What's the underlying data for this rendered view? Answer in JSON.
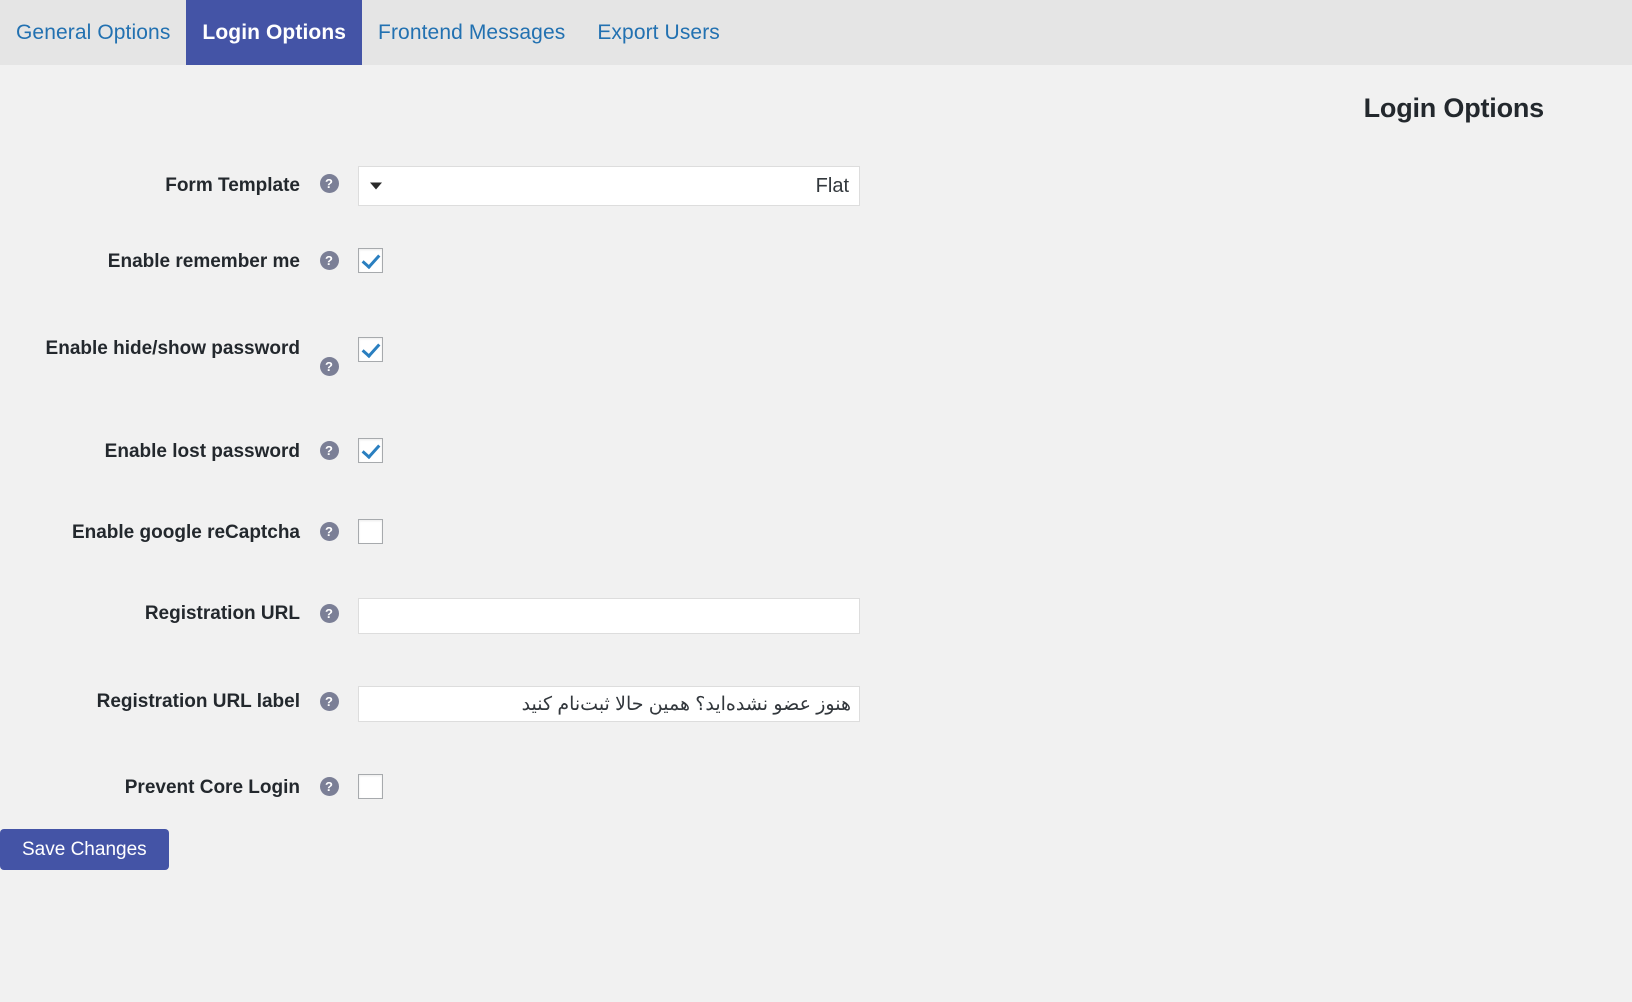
{
  "tabs": [
    {
      "label": "Export Users",
      "active": false
    },
    {
      "label": "Frontend Messages",
      "active": false
    },
    {
      "label": "Login Options",
      "active": true
    },
    {
      "label": "General Options",
      "active": false
    }
  ],
  "page": {
    "title": "Login Options"
  },
  "colors": {
    "active_tab_bg": "#4454a6",
    "tab_link": "#2271b1",
    "tabbar_bg": "#e5e5e5",
    "page_bg": "#f1f1f1",
    "checkmark": "#2a7fc0",
    "help_icon_bg": "#7b7f96",
    "button_bg": "#4454a6"
  },
  "help_icon": "?",
  "fields": {
    "form_template": {
      "label": "Form Template",
      "type": "select",
      "value": "Flat",
      "options": [
        "Flat"
      ],
      "help": "?"
    },
    "enable_remember_me": {
      "label": "Enable remember me",
      "type": "checkbox",
      "checked": true,
      "help": "?"
    },
    "enable_hide_show_password": {
      "label": "Enable hide/show password",
      "type": "checkbox",
      "checked": true,
      "help": "?"
    },
    "enable_lost_password": {
      "label": "Enable lost password",
      "type": "checkbox",
      "checked": true,
      "help": "?"
    },
    "enable_google_recaptcha": {
      "label": "Enable google reCaptcha",
      "type": "checkbox",
      "checked": false,
      "help": "?"
    },
    "registration_url": {
      "label": "Registration URL",
      "type": "text",
      "value": "",
      "placeholder": "",
      "help": "?"
    },
    "registration_url_label": {
      "label": "Registration URL label",
      "type": "text",
      "value": "هنوز عضو نشده‌اید؟ همین حالا ثبت‌نام کنید",
      "placeholder": "",
      "help": "?"
    },
    "prevent_core_login": {
      "label": "Prevent Core Login",
      "type": "checkbox",
      "checked": false,
      "help": "?"
    }
  },
  "submit": {
    "label": "Save Changes"
  }
}
